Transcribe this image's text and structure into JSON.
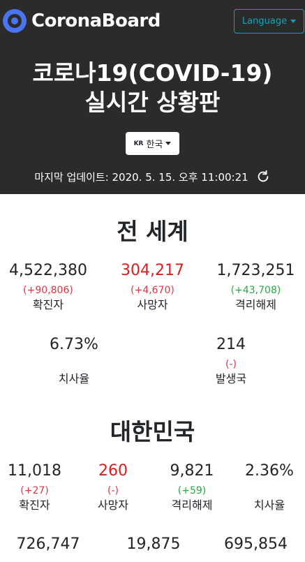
{
  "navbar": {
    "brand": "CoronaBoard",
    "language_label": "Language"
  },
  "header": {
    "title_line1": "코로나19(COVID-19)",
    "title_line2": "실시간 상황판",
    "country_flag": "KR",
    "country_label": "한국",
    "updated_label": "마지막 업데이트: 2020. 5. 15. 오후 11:00:21"
  },
  "world": {
    "title": "전 세계",
    "confirmed": {
      "value": "4,522,380",
      "delta": "(+90,806)",
      "label": "확진자"
    },
    "deaths": {
      "value": "304,217",
      "delta": "(+4,670)",
      "label": "사망자"
    },
    "recovered": {
      "value": "1,723,251",
      "delta": "(+43,708)",
      "label": "격리해제"
    },
    "fatality": {
      "value": "6.73%",
      "label": "치사율"
    },
    "countries": {
      "value": "214",
      "delta": "(-)",
      "label": "발생국"
    }
  },
  "korea": {
    "title": "대한민국",
    "confirmed": {
      "value": "11,018",
      "delta": "(+27)",
      "label": "확진자"
    },
    "deaths": {
      "value": "260",
      "delta": "(-)",
      "label": "사망자"
    },
    "recovered": {
      "value": "9,821",
      "delta": "(+59)",
      "label": "격리해제"
    },
    "fatality": {
      "value": "2.36%",
      "label": "치사율"
    },
    "row2": [
      {
        "value": "726,747"
      },
      {
        "value": "19,875"
      },
      {
        "value": "695,854"
      }
    ]
  },
  "colors": {
    "header_bg": "#2b2b2b",
    "accent": "#17a2b8",
    "brand": "#4a74f0",
    "red": "#dc3545",
    "green": "#28a745"
  }
}
